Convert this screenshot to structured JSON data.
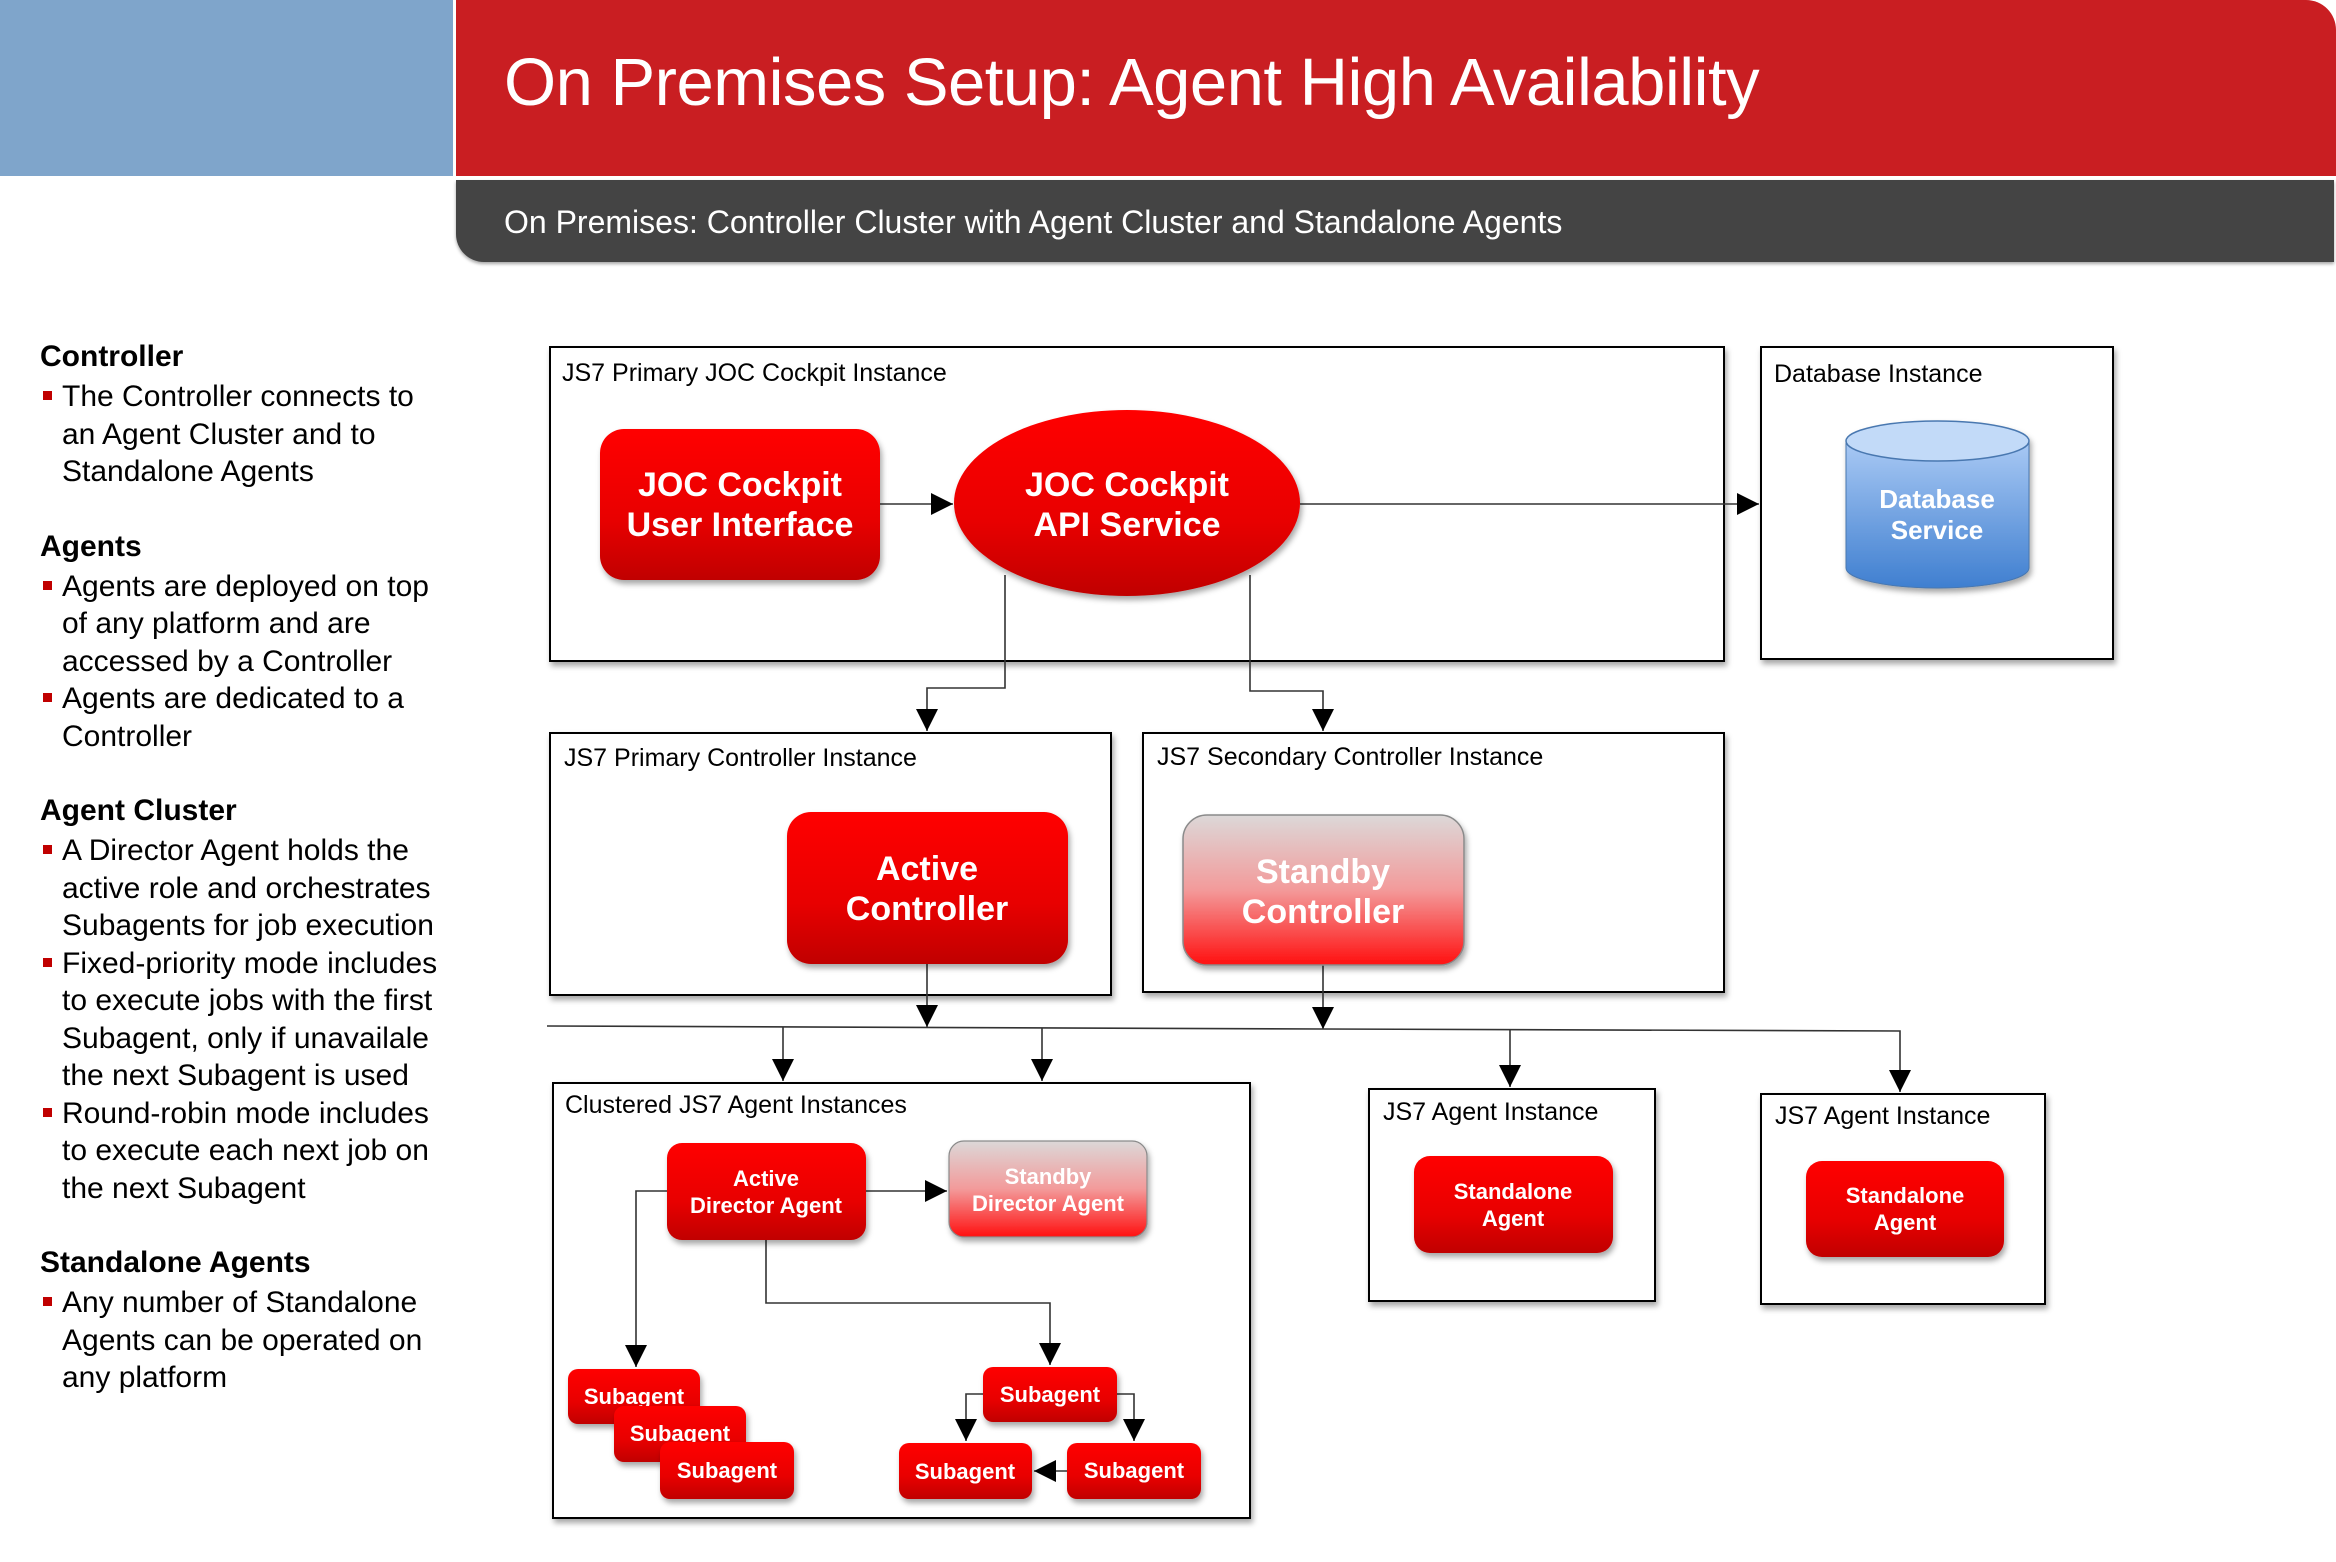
{
  "header": {
    "title": "On Premises Setup: Agent High Availability",
    "subtitle": "On Premises: Controller Cluster with Agent Cluster and Standalone Agents",
    "colors": {
      "title_bar": "#c91e22",
      "subtitle_bar": "#444444",
      "accent_block": "#7fa5cb"
    }
  },
  "sidebar": {
    "sections": [
      {
        "heading": "Controller",
        "items": [
          "The Controller connects to an Agent Cluster and to Standalone Agents"
        ]
      },
      {
        "heading": "Agents",
        "items": [
          "Agents are deployed on top of any platform and are accessed by a Controller",
          "Agents are dedicated to a Controller"
        ]
      },
      {
        "heading": "Agent Cluster",
        "items": [
          "A Director Agent holds the active role and orchestrates Subagents for job execution",
          "Fixed-priority mode includes to execute jobs with the first Subagent, only if unavailale the next Subagent is used",
          "Round-robin mode includes to execute each next job on the next Subagent"
        ]
      },
      {
        "heading": "Standalone Agents",
        "items": [
          "Any number of Standalone Agents can be operated on any platform"
        ]
      }
    ],
    "lines": [
      [
        "The Controller connects to",
        "an Agent Cluster and to",
        "Standalone Agents"
      ],
      [
        "Agents are deployed on top",
        "of any platform and are",
        "accessed by a Controller"
      ],
      [
        "Agents are dedicated to a",
        "Controller"
      ],
      [
        "A Director Agent holds the",
        "active role and orchestrates",
        "Subagents for job execution"
      ],
      [
        "Fixed-priority mode includes",
        "to execute jobs with the first",
        "Subagent, only if unavailale",
        "the next Subagent is used"
      ],
      [
        "Round-robin mode includes",
        "to execute each next job on",
        "the next Subagent"
      ],
      [
        "Any number of Standalone",
        "Agents can be operated on",
        "any platform"
      ]
    ],
    "bullet_color": "#c00000"
  },
  "diagram": {
    "containers": {
      "joc": "JS7 Primary JOC Cockpit Instance",
      "database": "Database Instance",
      "primary_controller": "JS7 Primary Controller Instance",
      "secondary_controller": "JS7 Secondary Controller Instance",
      "agent_cluster": "Clustered JS7 Agent Instances",
      "agent_instance_1": "JS7 Agent Instance",
      "agent_instance_2": "JS7 Agent Instance"
    },
    "nodes": {
      "joc_ui": [
        "JOC Cockpit",
        "User Interface"
      ],
      "joc_api": [
        "JOC Cockpit",
        "API Service"
      ],
      "database_service": [
        "Database",
        "Service"
      ],
      "active_controller": [
        "Active",
        "Controller"
      ],
      "standby_controller": [
        "Standby",
        "Controller"
      ],
      "active_director": [
        "Active",
        "Director Agent"
      ],
      "standby_director": [
        "Standby",
        "Director Agent"
      ],
      "subagent": "Subagent",
      "standalone_agent": [
        "Standalone",
        "Agent"
      ]
    },
    "colors": {
      "active_top": "#ff0000",
      "active_bottom": "#c00000",
      "standby_top": "#dcd8d8",
      "standby_bottom": "#ff1010",
      "db_top": "#c6dcf7",
      "db_bottom": "#3f7fd0"
    }
  }
}
